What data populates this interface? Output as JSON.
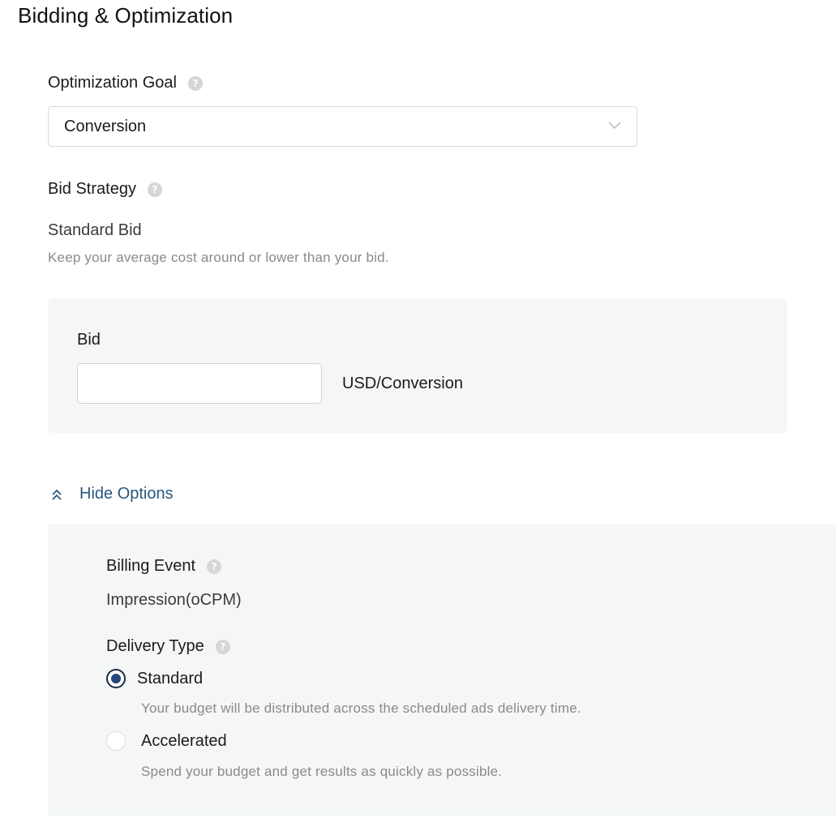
{
  "section": {
    "title": "Bidding & Optimization"
  },
  "optimization_goal": {
    "label": "Optimization Goal",
    "help_icon": "question-circle-icon",
    "selected_value": "Conversion",
    "dropdown_icon": "chevron-down-icon"
  },
  "bid_strategy": {
    "label": "Bid Strategy",
    "help_icon": "question-circle-icon",
    "value": "Standard Bid",
    "hint": "Keep your average cost around or lower than your bid."
  },
  "bid": {
    "label": "Bid",
    "input_value": "",
    "unit": "USD/Conversion"
  },
  "options_toggle": {
    "label": "Hide Options",
    "icon": "double-chevron-up-icon"
  },
  "billing_event": {
    "label": "Billing Event",
    "help_icon": "question-circle-icon",
    "value": "Impression(oCPM)"
  },
  "delivery_type": {
    "label": "Delivery Type",
    "help_icon": "question-circle-icon",
    "options": [
      {
        "label": "Standard",
        "description": "Your budget will be distributed across the scheduled ads delivery time.",
        "selected": true
      },
      {
        "label": "Accelerated",
        "description": "Spend your budget and get results as quickly as possible.",
        "selected": false
      }
    ]
  },
  "colors": {
    "link": "#2b5680",
    "radio_selected": "#24467f",
    "panel_background": "#f4f7f6",
    "hint_text": "#8a8a8a"
  }
}
